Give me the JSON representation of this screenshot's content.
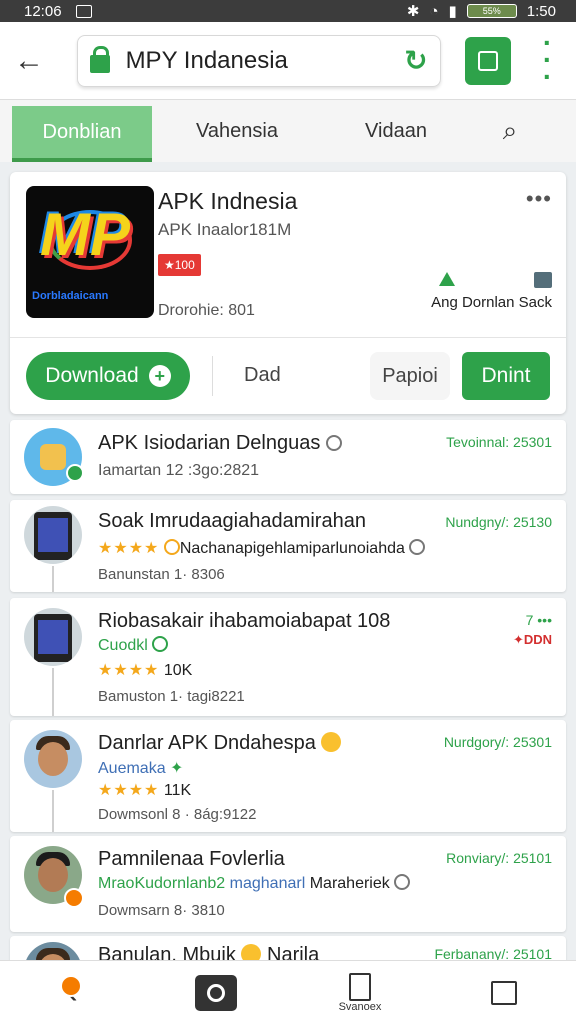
{
  "status": {
    "time_left": "12:06",
    "time_right": "1:50",
    "battery": "55%"
  },
  "address_bar": {
    "url_text": "MPY Indanesia"
  },
  "tabs": [
    {
      "label": "Donblian"
    },
    {
      "label": "Vahensia"
    },
    {
      "label": "Vidaan"
    }
  ],
  "app": {
    "name": "APK Indnesia",
    "subtitle": "APK Inaalor181M",
    "badge": "★100",
    "meta": "Drorohie: 801",
    "side_label": "Ang Dornlan Sack",
    "icon_text": "Dorbladaicann",
    "buttons": {
      "download": "Download",
      "dad": "Dad",
      "papio": "Papioi",
      "dnint": "Dnint"
    }
  },
  "list": [
    {
      "title": "APK Isiodarian Delnguas",
      "date": "Tevoinnal: 25301",
      "line2": "Iamartan  12 :3go:2821"
    },
    {
      "title": "Soak Imrudaagiahadamirahan",
      "date": "Nundgny/: 25130",
      "stars": "★★★★",
      "line2_text": "Nachanapigehlamiparlunoiahda",
      "line3": "Banunstan  1· 8306"
    },
    {
      "title": "Riobasakair ihabamoiabapat 108",
      "date": "7 •••",
      "badge_right": "✦DDN",
      "line2": "Cuodkl",
      "stars": "★★★★",
      "rating_count": "10K",
      "line3": "Bamuston  1· tagi8221"
    },
    {
      "title": "Danrlar APK Dndahespa",
      "date": "Nurdgory/: 25301",
      "line2": "Auemaka",
      "stars": "★★★★",
      "rating_count": "11K",
      "line3": "Dowmsonl  8 · 8ág:9122"
    },
    {
      "title": "Pamnilenaa Fovlerlia",
      "date": "Ronviary/: 25101",
      "line2_green": "MraoKudornlanb2",
      "line2_blue": "maghanarl",
      "line2_rest": "Maraheriek",
      "line3": "Dowmsarn  8· 3810"
    },
    {
      "title": "Banulan. Mbuik",
      "title_tail": "Narila",
      "date": "Ferbanany/: 25101"
    }
  ],
  "bottom_nav": {
    "tab_label": "Svanoex"
  }
}
